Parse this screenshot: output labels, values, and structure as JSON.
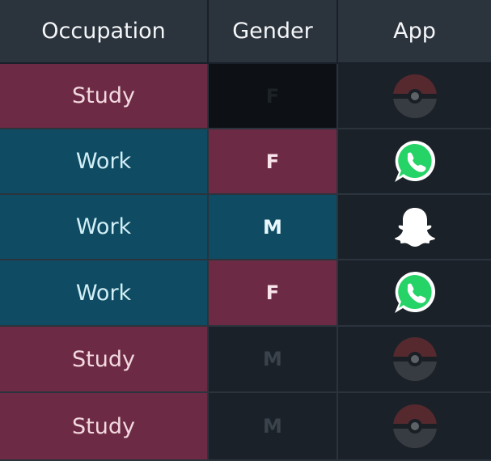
{
  "headers": [
    "Occupation",
    "Gender",
    "App"
  ],
  "rows": [
    {
      "occupation": "Study",
      "gender": "F",
      "app": "pokeball-icon",
      "highlight": false
    },
    {
      "occupation": "Work",
      "gender": "F",
      "app": "whatsapp-icon",
      "highlight": true
    },
    {
      "occupation": "Work",
      "gender": "M",
      "app": "snapchat-icon",
      "highlight": true
    },
    {
      "occupation": "Work",
      "gender": "F",
      "app": "whatsapp-icon",
      "highlight": true
    },
    {
      "occupation": "Study",
      "gender": "M",
      "app": "pokeball-icon",
      "highlight": false
    },
    {
      "occupation": "Study",
      "gender": "M",
      "app": "pokeball-icon",
      "highlight": false
    }
  ],
  "colors": {
    "study": "#6d2a44",
    "work": "#0f4c63",
    "header": "#2b333d",
    "whatsapp": "#25d366"
  }
}
